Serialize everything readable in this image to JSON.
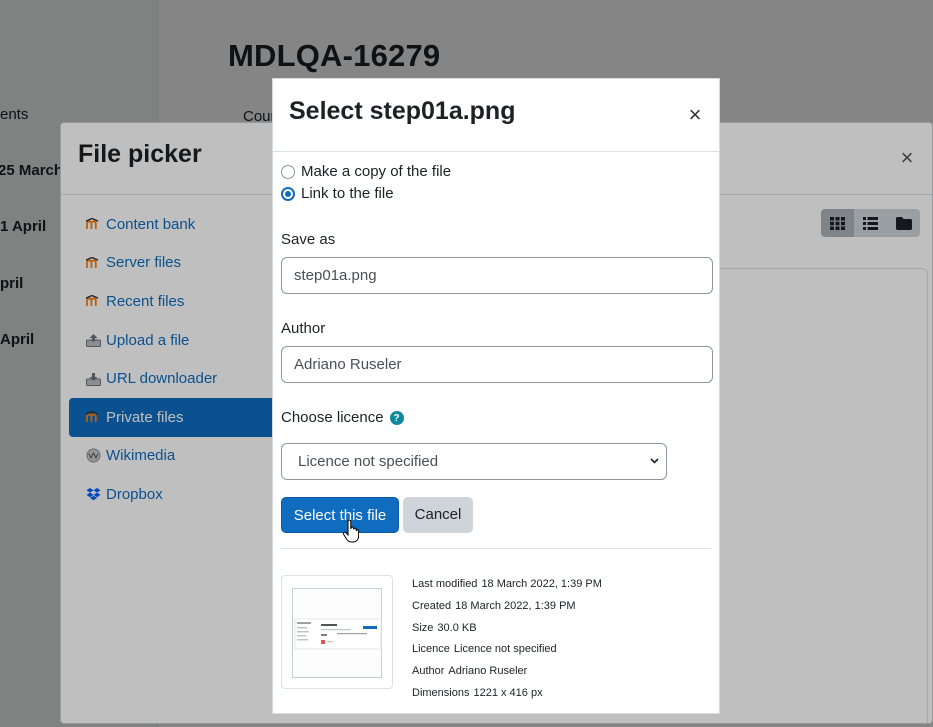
{
  "page": {
    "title": "MDLQA-16279",
    "fragments": {
      "nav_partial": "ents",
      "course_partial": "Cour",
      "date1": "25 March",
      "date2": "1 April",
      "date3": "pril",
      "date4": "April"
    }
  },
  "file_picker": {
    "title": "File picker",
    "repositories": [
      {
        "label": "Content bank",
        "icon": "moodle-icon"
      },
      {
        "label": "Server files",
        "icon": "moodle-icon"
      },
      {
        "label": "Recent files",
        "icon": "moodle-icon"
      },
      {
        "label": "Upload a file",
        "icon": "upload-icon"
      },
      {
        "label": "URL downloader",
        "icon": "url-download-icon"
      },
      {
        "label": "Private files",
        "icon": "moodle-icon",
        "active": true
      },
      {
        "label": "Wikimedia",
        "icon": "wikimedia-icon"
      },
      {
        "label": "Dropbox",
        "icon": "dropbox-icon"
      }
    ],
    "view_modes": [
      "grid-icon",
      "list-icon",
      "folder-icon"
    ]
  },
  "select_dialog": {
    "title": "Select step01a.png",
    "options": {
      "copy_label": "Make a copy of the file",
      "link_label": "Link to the file",
      "selected": "link"
    },
    "save_as": {
      "label": "Save as",
      "value": "step01a.png"
    },
    "author": {
      "label": "Author",
      "value": "Adriano Ruseler"
    },
    "licence": {
      "label": "Choose licence",
      "selected": "Licence not specified"
    },
    "buttons": {
      "select": "Select this file",
      "cancel": "Cancel"
    },
    "file_info": {
      "last_modified": {
        "key": "Last modified",
        "value": "18 March 2022, 1:39 PM"
      },
      "created": {
        "key": "Created",
        "value": "18 March 2022, 1:39 PM"
      },
      "size": {
        "key": "Size",
        "value": "30.0 KB"
      },
      "licence": {
        "key": "Licence",
        "value": "Licence not specified"
      },
      "author": {
        "key": "Author",
        "value": "Adriano Ruseler"
      },
      "dimensions": {
        "key": "Dimensions",
        "value": "1221 x 416 px"
      }
    }
  },
  "colors": {
    "primary": "#0f6cbf",
    "help": "#0f8a9d",
    "secondary_button": "#ced4da"
  }
}
